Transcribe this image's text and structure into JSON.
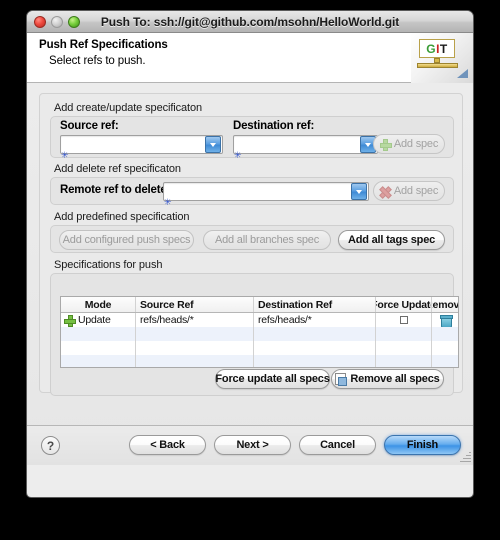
{
  "window": {
    "title": "Push To: ssh://git@github.com/msohn/HelloWorld.git",
    "traffic": {
      "close": "close-button",
      "minimize": "minimize-button",
      "zoom": "zoom-button"
    }
  },
  "banner": {
    "title": "Push Ref Specifications",
    "subtitle": "Select refs to push.",
    "logo": {
      "g": "G",
      "i": "I",
      "t": "T"
    }
  },
  "groups": {
    "create_update": {
      "label": "Add create/update specificaton",
      "source_label": "Source ref:",
      "source_value": "",
      "destination_label": "Destination ref:",
      "destination_value": "",
      "add_spec_label": "Add spec"
    },
    "delete_ref": {
      "label": "Add delete ref specificaton",
      "remote_label": "Remote ref to delete:",
      "remote_value": "",
      "add_spec_label": "Add spec"
    },
    "predefined": {
      "label": "Add predefined specification",
      "add_configured_label": "Add configured push specs",
      "add_branches_label": "Add all branches spec",
      "add_tags_label": "Add all tags spec"
    },
    "specs": {
      "label": "Specifications for push",
      "columns": [
        "Mode",
        "Source Ref",
        "Destination Ref",
        "Force Update",
        "Remove"
      ],
      "rows": [
        {
          "mode": "Update",
          "source_ref": "refs/heads/*",
          "destination_ref": "refs/heads/*",
          "force_update": false,
          "remove": "trash-icon"
        }
      ],
      "empty_rows": 4,
      "force_update_all_label": "Force update all specs",
      "remove_all_label": "Remove all specs"
    }
  },
  "footer": {
    "help_label": "?",
    "back_label": "< Back",
    "next_label": "Next >",
    "cancel_label": "Cancel",
    "finish_label": "Finish"
  },
  "colors": {
    "accent": "#3d93e6",
    "plus_green": "#76c043",
    "delete_red": "#dd9f9f",
    "trash_blue": "#4ba6c4",
    "row_stripe": "#edf2fb"
  }
}
